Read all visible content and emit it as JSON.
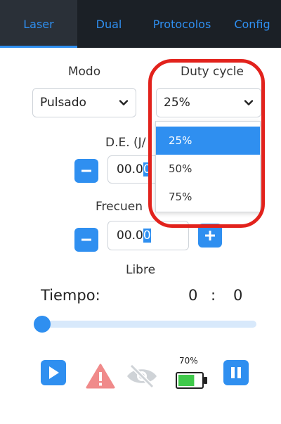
{
  "tabs": [
    {
      "label": "Laser",
      "active": true
    },
    {
      "label": "Dual",
      "active": false
    },
    {
      "label": "Protocolos",
      "active": false
    },
    {
      "label": "Config",
      "active": false
    }
  ],
  "mode": {
    "label": "Modo",
    "value": "Pulsado"
  },
  "duty": {
    "label": "Duty cycle",
    "value": "25%",
    "options": [
      "25%",
      "50%",
      "75%"
    ],
    "selected_index": 0
  },
  "de": {
    "label": "D.E. (J/",
    "value_prefix": "00.0",
    "value_caret": "0"
  },
  "frecuencia": {
    "label": "Frecuen",
    "value_prefix": "00.0",
    "value_caret": "0"
  },
  "libre_label": "Libre",
  "tiempo": {
    "label": "Tiempo:",
    "minutes": "0",
    "separator": ":",
    "seconds": "0"
  },
  "slider": {
    "value_fraction": 0.0
  },
  "battery": {
    "percent_label": "70%",
    "level": 0.7
  },
  "colors": {
    "accent": "#2f8ff0",
    "nav_bg": "#1b2026",
    "warning": "#f08a8a",
    "battery_fill": "#3fc94a",
    "highlight": "#e2221c"
  },
  "icons": [
    "play-icon",
    "warning-icon",
    "eye-slash-icon",
    "battery-icon",
    "pause-icon",
    "chevron-down-icon",
    "minus-icon",
    "plus-icon"
  ]
}
